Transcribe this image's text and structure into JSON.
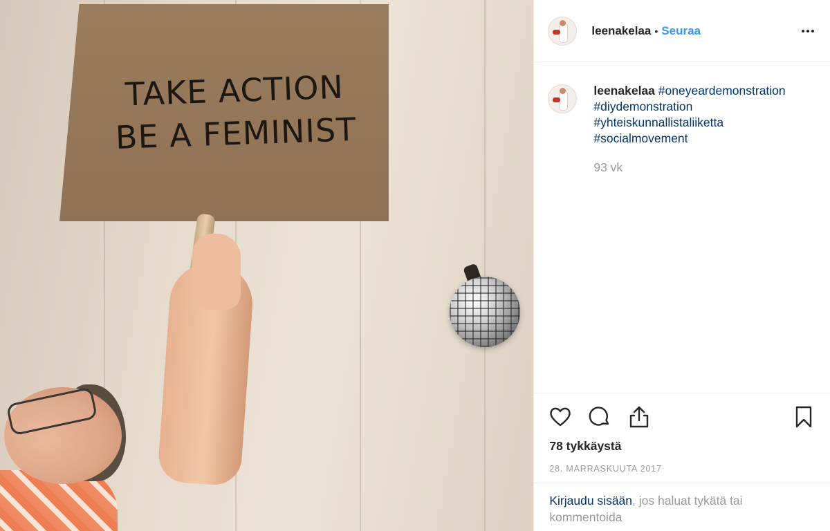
{
  "photo": {
    "sign_lines": [
      "TAKE ACTION",
      "BE A FEMINIST"
    ]
  },
  "header": {
    "username": "leenakelaa",
    "separator": "•",
    "follow_label": "Seuraa"
  },
  "caption": {
    "username": "leenakelaa",
    "hashtags": [
      "#oneyeardemonstration",
      "#diydemonstration",
      "#yhteiskunnallistaliiketta",
      "#socialmovement"
    ],
    "time_ago": "93 vk"
  },
  "actions": {
    "icons": [
      "heart-icon",
      "comment-icon",
      "share-icon",
      "bookmark-icon"
    ],
    "likes": "78 tykkäystä",
    "date": "28. MARRASKUUTA 2017"
  },
  "login": {
    "link": "Kirjaudu sisään",
    "text": ", jos haluat tykätä tai kommentoida"
  },
  "colors": {
    "link_blue": "#3897f0",
    "hashtag": "#003569",
    "muted": "#999999",
    "text": "#262626"
  }
}
